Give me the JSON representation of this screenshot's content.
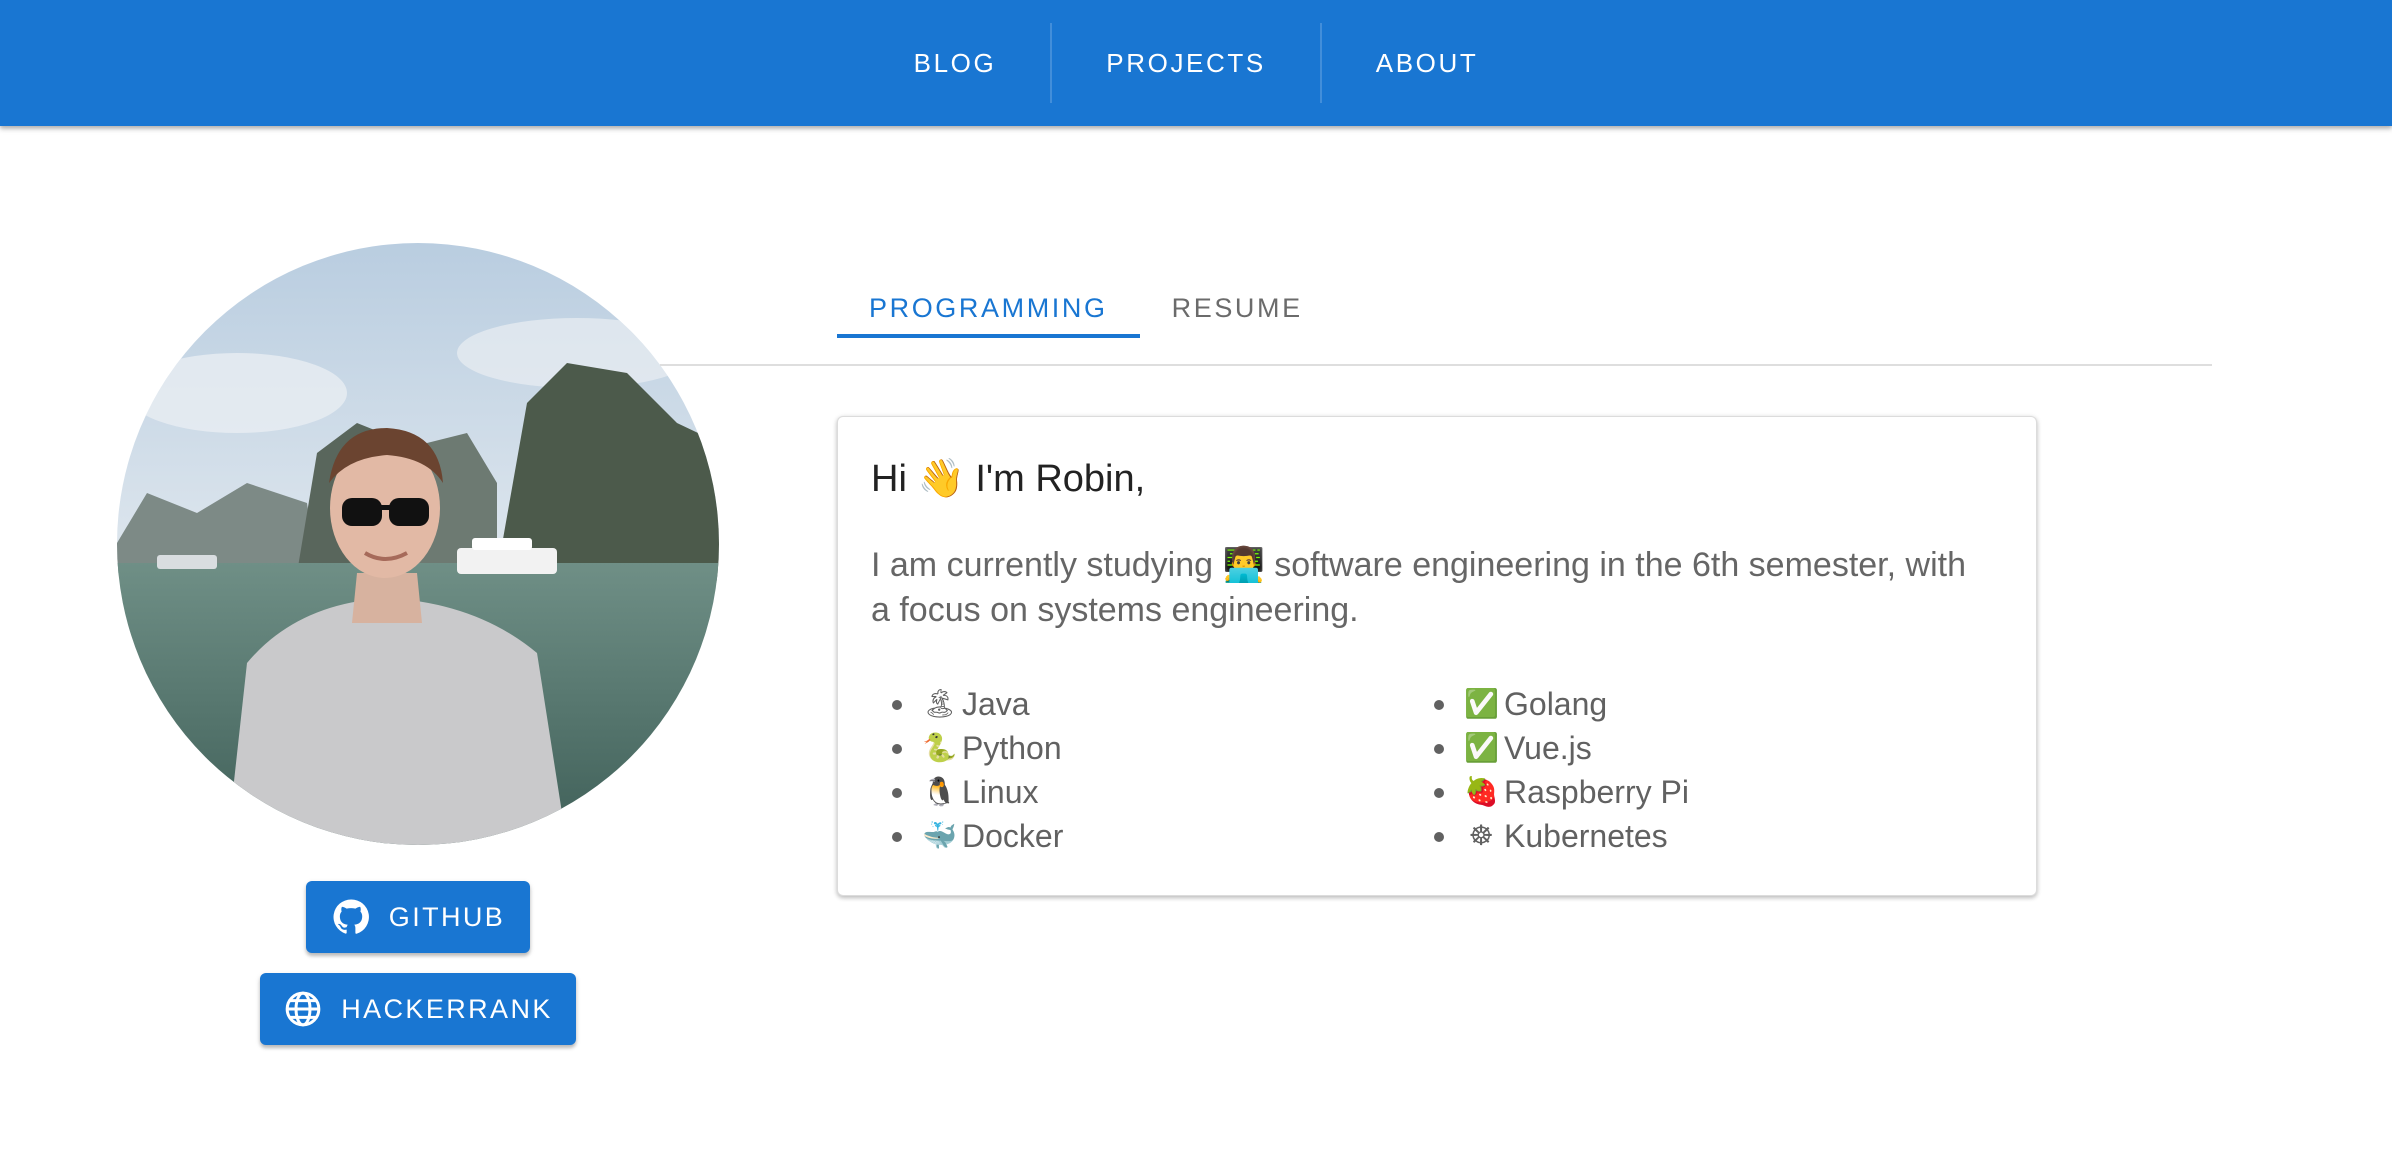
{
  "nav": {
    "items": [
      {
        "label": "BLOG"
      },
      {
        "label": "PROJECTS"
      },
      {
        "label": "ABOUT"
      }
    ]
  },
  "profile": {
    "buttons": {
      "github": "GITHUB",
      "hackerrank": "HACKERRANK"
    }
  },
  "tabs": [
    {
      "label": "PROGRAMMING",
      "active": true
    },
    {
      "label": "RESUME",
      "active": false
    }
  ],
  "card": {
    "title": "Hi 👋 I'm Robin,",
    "text": "I am currently studying 👨‍💻 software engineering in the 6th semester, with a focus on systems engineering.",
    "skills_left": [
      {
        "emoji": "🏝",
        "label": "Java"
      },
      {
        "emoji": "🐍",
        "label": "Python"
      },
      {
        "emoji": "🐧",
        "label": "Linux"
      },
      {
        "emoji": "🐳",
        "label": "Docker"
      }
    ],
    "skills_right": [
      {
        "emoji": "✅",
        "label": "Golang"
      },
      {
        "emoji": "✅",
        "label": "Vue.js"
      },
      {
        "emoji": "🍓",
        "label": "Raspberry Pi"
      },
      {
        "emoji": "☸",
        "label": "Kubernetes"
      }
    ]
  },
  "colors": {
    "primary": "#1976d2",
    "text_muted": "#666666"
  }
}
